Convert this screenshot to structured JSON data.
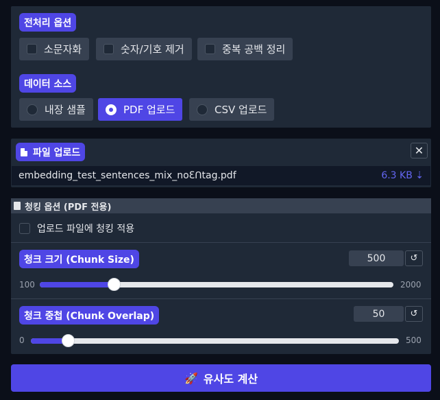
{
  "preprocess": {
    "title": "전처리 옵션",
    "options": [
      {
        "label": "소문자화",
        "checked": false
      },
      {
        "label": "숫자/기호 제거",
        "checked": false
      },
      {
        "label": "중복 공백 정리",
        "checked": false
      }
    ]
  },
  "datasource": {
    "title": "데이터 소스",
    "options": [
      {
        "label": "내장 샘플",
        "selected": false
      },
      {
        "label": "PDF 업로드",
        "selected": true
      },
      {
        "label": "CSV 업로드",
        "selected": false
      }
    ]
  },
  "upload": {
    "title": "파일 업로드",
    "file_name": "embedding_test_sentences_mix_noƐꓵtag.pdf",
    "file_size": "6.3 KB ⇣"
  },
  "chunking": {
    "title": "청킹 옵션 (PDF 전용)",
    "apply_label": "업로드 파일에 청킹 적용",
    "apply_checked": false,
    "size": {
      "label": "청크 크기 (Chunk Size)",
      "value": "500",
      "min": "100",
      "max": "2000",
      "fraction": 0.21
    },
    "overlap": {
      "label": "청크 중첩 (Chunk Overlap)",
      "value": "50",
      "min": "0",
      "max": "500",
      "fraction": 0.1
    },
    "reset_glyph": "↺"
  },
  "action": {
    "emoji": "🚀",
    "label": "유사도 계산"
  }
}
